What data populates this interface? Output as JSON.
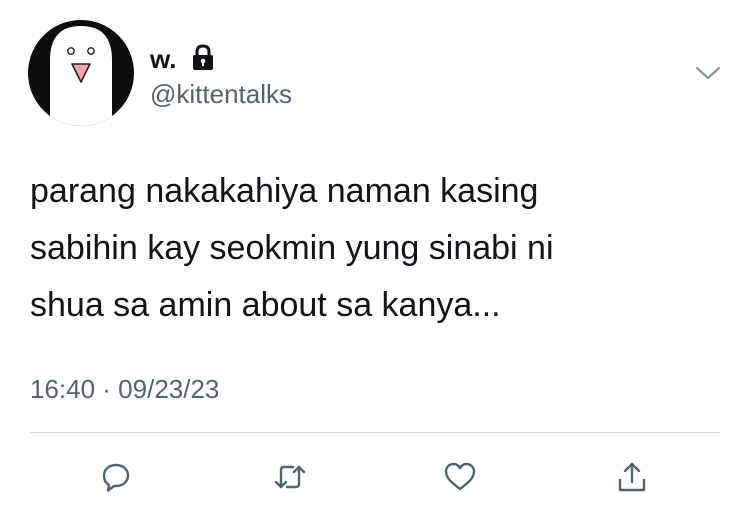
{
  "author": {
    "display_name": "w.",
    "handle": "@kittentalks",
    "protected_icon": "lock-icon",
    "avatar_icon": "ghost-avatar"
  },
  "tweet": {
    "text": "parang nakakahiya naman kasing\nsabihin kay seokmin yung sinabi ni\nshua sa amin about sa kanya...",
    "timestamp": "16:40 · 09/23/23"
  },
  "menu_icon": "chevron-down-icon",
  "actions": [
    {
      "name": "reply",
      "icon": "reply-icon"
    },
    {
      "name": "retweet",
      "icon": "retweet-icon"
    },
    {
      "name": "like",
      "icon": "heart-icon"
    },
    {
      "name": "share",
      "icon": "share-icon"
    }
  ],
  "colors": {
    "text": "#0f1419",
    "secondary": "#536471",
    "divider": "#cfd9de",
    "avatar_bg": "#0c0c0c",
    "avatar_beak": "#f5a5ad"
  }
}
